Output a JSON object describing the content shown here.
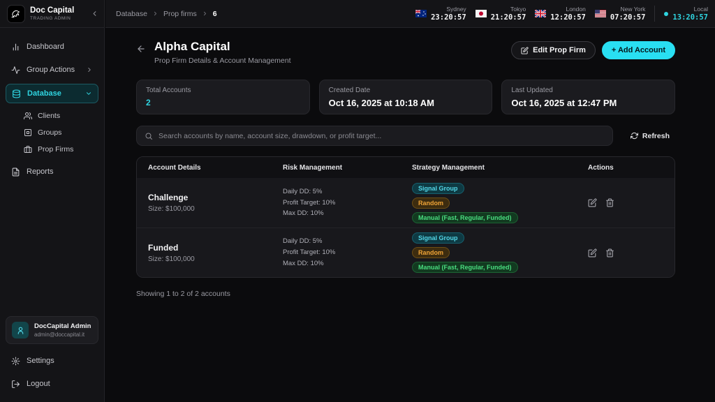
{
  "colors": {
    "accent": "#29dff2",
    "accent_text": "#2fd4e0",
    "badge_signal": "#53d7e8",
    "badge_random": "#f0a437",
    "badge_manual": "#4ade80"
  },
  "sidebar": {
    "brand": {
      "name": "Doc Capital",
      "subtitle": "TRADING ADMIN"
    },
    "items": {
      "dashboard": "Dashboard",
      "group_actions": "Group Actions",
      "database": "Database",
      "clients": "Clients",
      "groups": "Groups",
      "prop_firms": "Prop Firms",
      "reports": "Reports"
    },
    "user": {
      "name": "DocCapital Admin",
      "email": "admin@doccapital.it"
    },
    "settings_label": "Settings",
    "logout_label": "Logout"
  },
  "topbar": {
    "breadcrumb": [
      "Database",
      "Prop firms",
      "6"
    ],
    "clocks": [
      {
        "city": "Sydney",
        "time": "23:20:57",
        "flag": "australia-flag"
      },
      {
        "city": "Tokyo",
        "time": "21:20:57",
        "flag": "japan-flag"
      },
      {
        "city": "London",
        "time": "12:20:57",
        "flag": "uk-flag"
      },
      {
        "city": "New York",
        "time": "07:20:57",
        "flag": "us-flag"
      },
      {
        "city": "Local",
        "time": "13:20:57",
        "flag": "local-dot"
      }
    ]
  },
  "header": {
    "title": "Alpha Capital",
    "subtitle": "Prop Firm Details & Account Management",
    "edit_button": "Edit Prop Firm",
    "add_button": "+ Add Account"
  },
  "stats": [
    {
      "label": "Total Accounts",
      "value": "2"
    },
    {
      "label": "Created Date",
      "value": "Oct 16, 2025 at 10:18 AM"
    },
    {
      "label": "Last Updated",
      "value": "Oct 16, 2025 at 12:47 PM"
    }
  ],
  "search": {
    "placeholder": "Search accounts by name, account size, drawdown, or profit target...",
    "refresh_label": "Refresh"
  },
  "table": {
    "columns": [
      "Account Details",
      "Risk Management",
      "Strategy Management",
      "Actions"
    ],
    "rows": [
      {
        "name": "Challenge",
        "size": "Size: $100,000",
        "risk": [
          "Daily DD: 5%",
          "Profit Target: 10%",
          "Max DD: 10%"
        ],
        "badges": [
          "Signal Group",
          "Random",
          "Manual (Fast, Regular, Funded)"
        ]
      },
      {
        "name": "Funded",
        "size": "Size: $100,000",
        "risk": [
          "Daily DD: 5%",
          "Profit Target: 10%",
          "Max DD: 10%"
        ],
        "badges": [
          "Signal Group",
          "Random",
          "Manual (Fast, Regular, Funded)"
        ]
      }
    ],
    "footer": "Showing 1 to 2 of 2 accounts"
  }
}
